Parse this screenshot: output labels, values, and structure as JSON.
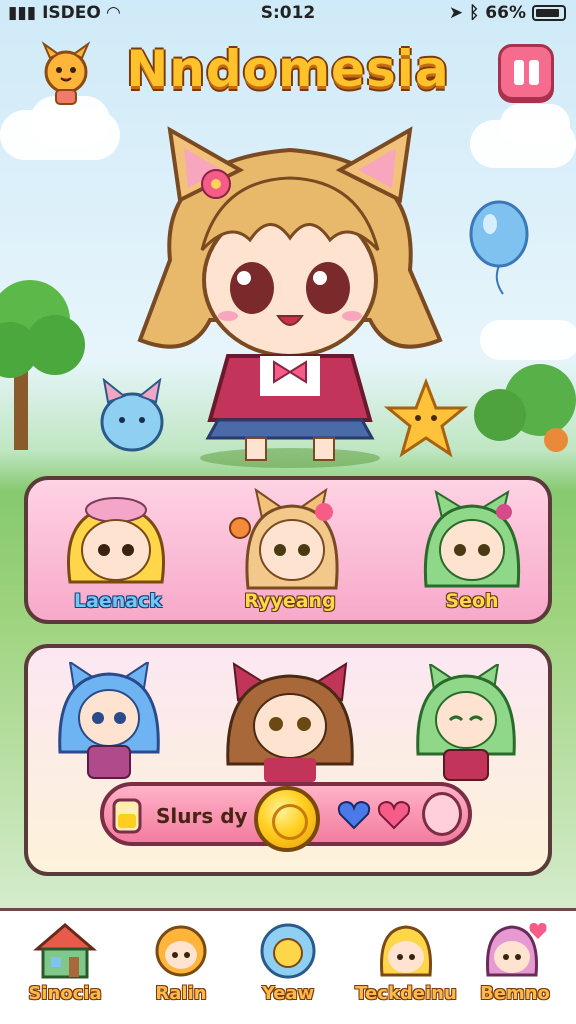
{
  "status_bar": {
    "carrier": "ISDEO",
    "time": "S:012",
    "battery": "66%"
  },
  "header": {
    "title": "Nndomesia"
  },
  "top_row": {
    "characters": [
      {
        "name": "Laenack"
      },
      {
        "name": "Ryyeang"
      },
      {
        "name": "Seoh"
      }
    ]
  },
  "status_pill": {
    "text": "Slurs dy"
  },
  "nav": {
    "items": [
      {
        "label": "Sinocia"
      },
      {
        "label": "Ralin"
      },
      {
        "label": "Yeaw"
      },
      {
        "label": "Teckdeinu"
      },
      {
        "label": "Bemno"
      }
    ]
  },
  "colors": {
    "title": "#ffc22a",
    "pause": "#f56c8e",
    "panel_pink": "#f7a9c9",
    "coin": "#ffcf1f"
  }
}
